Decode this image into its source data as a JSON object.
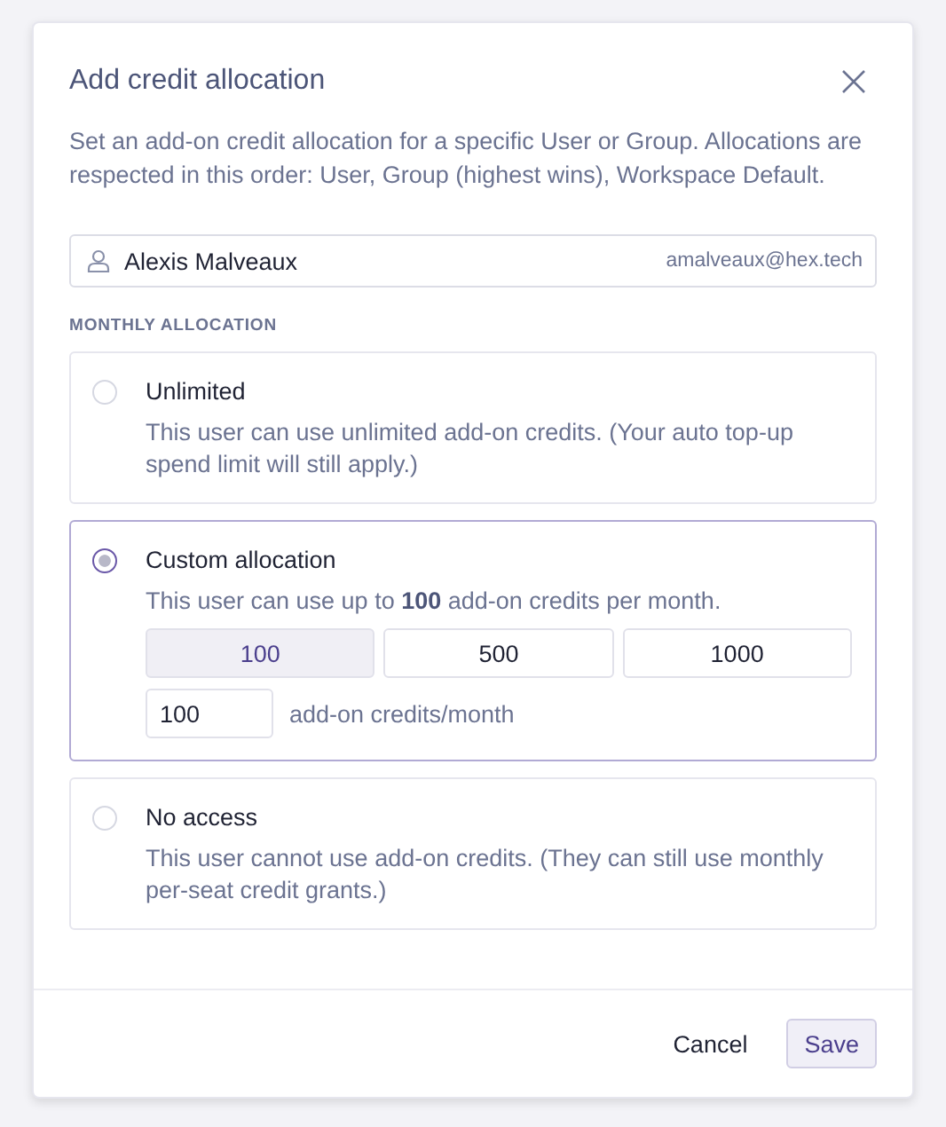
{
  "dialog": {
    "title": "Add credit allocation",
    "description": "Set an add-on credit allocation for a specific User or Group. Allocations are respected in this order: User, Group (highest wins), Workspace Default.",
    "user": {
      "name": "Alexis Malveaux",
      "email": "amalveaux@hex.tech"
    },
    "section_label": "MONTHLY ALLOCATION",
    "options": [
      {
        "label": "Unlimited",
        "description": "This user can use unlimited add-on credits. (Your auto top-up spend limit will still apply.)",
        "selected": false
      },
      {
        "label": "Custom allocation",
        "description": "This user can use up to **100** add-on credits per month.",
        "selected": true,
        "presets": [
          {
            "label": "100",
            "selected": true
          },
          {
            "label": "500",
            "selected": false
          },
          {
            "label": "1000",
            "selected": false
          }
        ],
        "amount": {
          "value": "100",
          "suffix": "add-on credits/month"
        }
      },
      {
        "label": "No access",
        "description": "This user cannot use add-on credits. (They can still use monthly per-seat credit grants.)",
        "selected": false
      }
    ],
    "buttons": [
      {
        "label": "Cancel",
        "kind": "plain"
      },
      {
        "label": "Save",
        "kind": "primary"
      }
    ]
  }
}
